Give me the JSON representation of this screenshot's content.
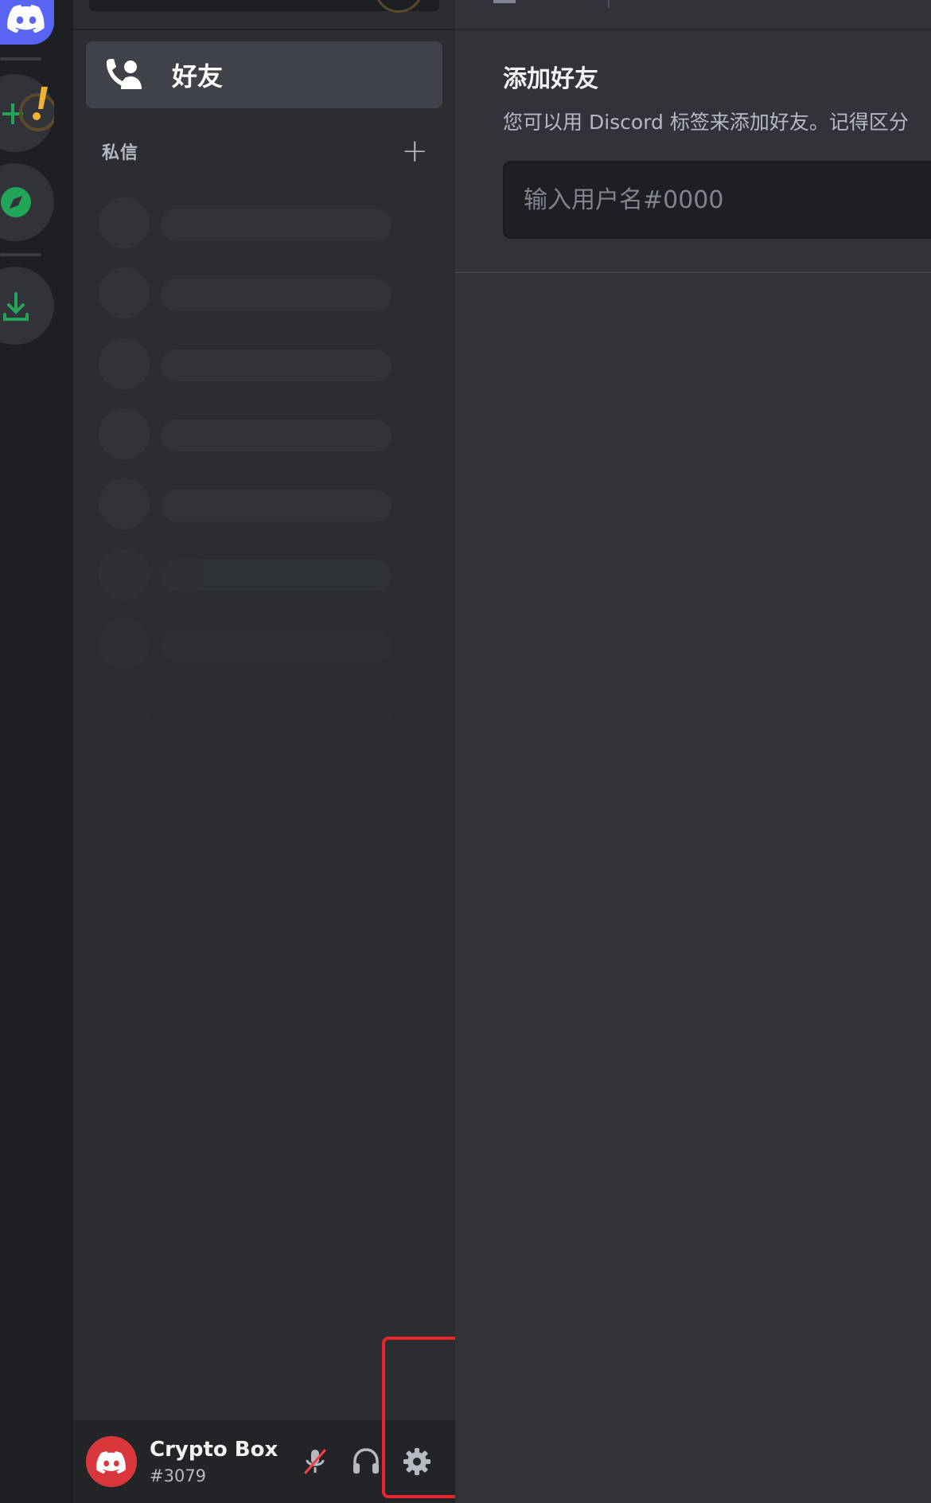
{
  "sidebar": {
    "friends_label": "好友",
    "dm_title": "私信",
    "dm_add": "+"
  },
  "user": {
    "name": "Crypto Box",
    "tag": "#3079"
  },
  "main": {
    "title": "添加好友",
    "description": "您可以用 Discord 标签来添加好友。记得区分",
    "input_placeholder": "输入用户名#0000"
  },
  "colors": {
    "blurple": "#5865f2",
    "green": "#23a559",
    "red": "#da373c",
    "highlight": "#e8262b",
    "warning": "#f0b232"
  },
  "icons": {
    "home": "discord-logo-icon",
    "add_server": "add-server-icon",
    "explore": "compass-icon",
    "download": "download-icon",
    "friends": "friends-icon",
    "mute": "mic-muted-icon",
    "deafen": "headphones-icon",
    "settings": "gear-icon"
  }
}
